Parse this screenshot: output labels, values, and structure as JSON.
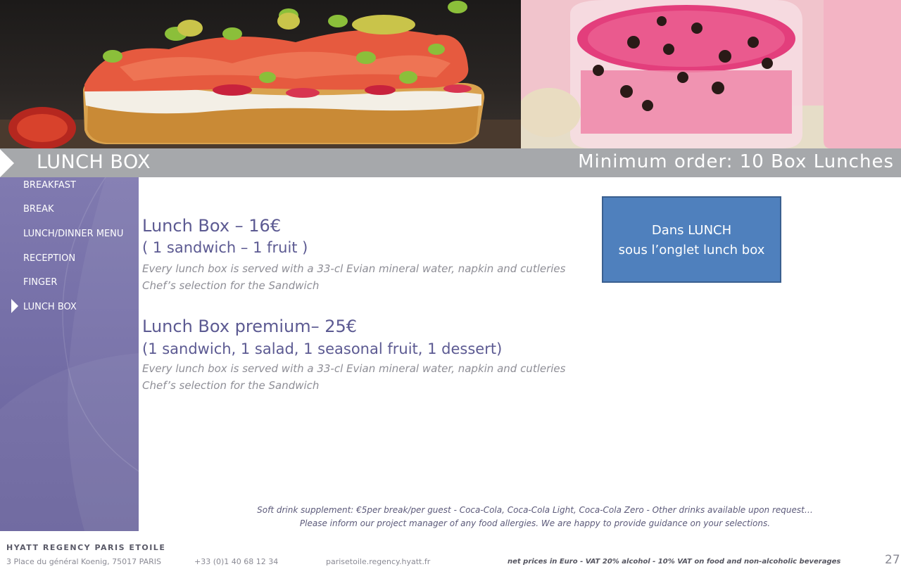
{
  "band": {
    "title": "LUNCH BOX",
    "minimum": "Minimum order: 10 Box Lunches"
  },
  "sidebar": {
    "items": [
      {
        "label": "BREAKFAST",
        "active": false
      },
      {
        "label": "BREAK",
        "active": false
      },
      {
        "label": "LUNCH/DINNER MENU",
        "active": false
      },
      {
        "label": "RECEPTION",
        "active": false
      },
      {
        "label": "FINGER",
        "active": false
      },
      {
        "label": "LUNCH BOX",
        "active": true
      }
    ]
  },
  "menu": {
    "items": [
      {
        "title": "Lunch Box – 16€",
        "subtitle": "( 1 sandwich  – 1 fruit )",
        "note1": "Every lunch box is served with a 33-cl Evian mineral water, napkin and cutleries",
        "note2": "Chef’s selection  for the Sandwich"
      },
      {
        "title": "Lunch Box premium– 25€",
        "subtitle": "(1 sandwich,  1 salad, 1 seasonal  fruit, 1 dessert)",
        "note1": "Every lunch box is served with a 33-cl Evian mineral water, napkin and cutleries",
        "note2": "Chef’s selection  for the Sandwich"
      }
    ]
  },
  "notebox": {
    "line1": "Dans LUNCH",
    "line2": "sous l’onglet lunch box"
  },
  "bottom": {
    "supplement": "Soft drink supplement: €5per break/per guest - Coca-Cola, Coca-Cola Light, Coca-Cola Zero - Other drinks available upon request…",
    "allergies": "Please inform our project manager of any food allergies. We are happy to provide guidance on your selections."
  },
  "footer": {
    "brand": "HYATT REGENCY PARIS ETOILE",
    "address": "3 Place du général Koenig,  75017 PARIS",
    "phone": "+33 (0)1 40 68 12 34",
    "website": "parisetoile.regency.hyatt.fr",
    "vat": "net prices in Euro - VAT 20% alcohol - 10% VAT on food  and non-alcoholic beverages",
    "page": "27"
  },
  "colors": {
    "band": "#a6a8ab",
    "sidebar": "#736da6",
    "heading": "#5c5a92",
    "notebox": "#4f80bd"
  },
  "images": {
    "left": "sandwich-photo",
    "right": "dessert-jar-photo"
  }
}
